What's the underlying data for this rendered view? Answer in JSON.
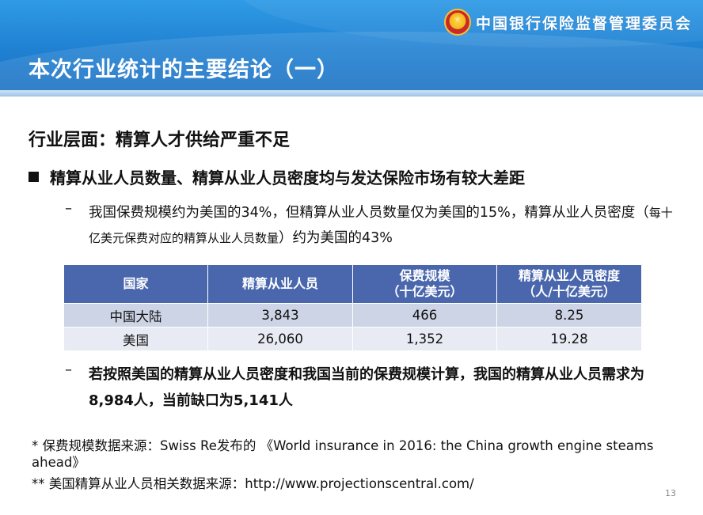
{
  "header": {
    "org_name": "中国银行保险监督管理委员会",
    "title": "本次行业统计的主要结论（一）"
  },
  "content": {
    "section_heading": "行业层面：精算人才供给严重不足",
    "bullet": "精算从业人员数量、精算从业人员密度均与发达保险市场有较大差距",
    "sub1_part1": "我国保费规模约为美国的34%，但精算从业人员数量仅为美国的15%，精算从业人员密度（",
    "sub1_small": "每十亿美元保费对应的精算从业人员数量",
    "sub1_part2": "）约为美国的43%",
    "sub2": "若按照美国的精算从业人员密度和我国当前的保费规模计算，我国的精算从业人员需求为8,984人，当前缺口为5,141人"
  },
  "table": {
    "headers": [
      {
        "line1": "国家",
        "line2": ""
      },
      {
        "line1": "精算从业人员",
        "line2": ""
      },
      {
        "line1": "保费规模",
        "line2": "（十亿美元）"
      },
      {
        "line1": "精算从业人员密度",
        "line2": "（人/十亿美元）"
      }
    ],
    "rows": [
      [
        "中国大陆",
        "3,843",
        "466",
        "8.25"
      ],
      [
        "美国",
        "26,060",
        "1,352",
        "19.28"
      ]
    ]
  },
  "footnotes": {
    "fn1": "* 保费规模数据来源：Swiss Re发布的 《World insurance in 2016: the China growth engine steams ahead》",
    "fn2": "** 美国精算从业人员相关数据来源：http://www.projectionscentral.com/"
  },
  "page_number": "13",
  "colors": {
    "header_blue": "#1f7fd0",
    "table_header": "#4a67ad",
    "row_odd": "#cdd4e6",
    "row_even": "#e8ebf3"
  }
}
